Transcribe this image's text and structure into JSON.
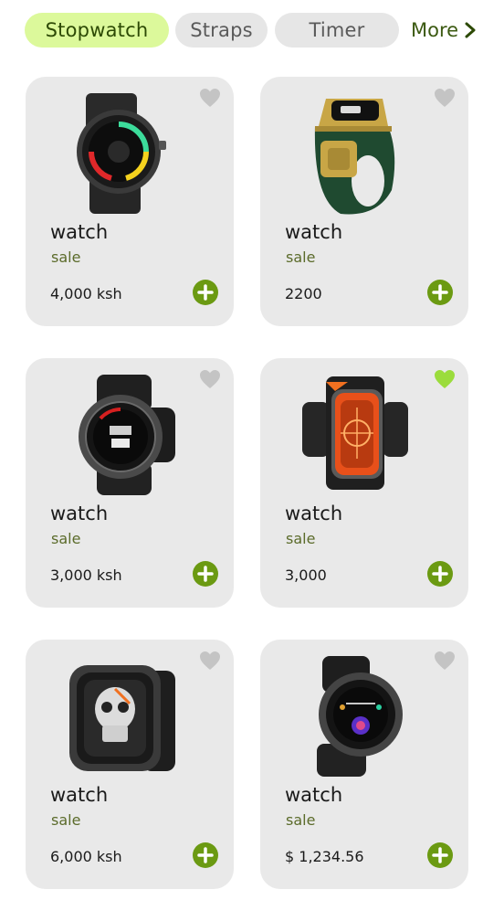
{
  "tabs": {
    "items": [
      "Stopwatch",
      "Straps",
      "Timer"
    ],
    "more_label": "More"
  },
  "colors": {
    "accent_chip": "#dcf99b",
    "accent_green": "#6b9a12",
    "heart_active": "#9bdc3c",
    "heart_inactive": "#c4c4c4",
    "card_bg": "#e9e9e9"
  },
  "products": [
    {
      "title": "watch",
      "sale": "sale",
      "price": "4,000 ksh",
      "favorite": false,
      "image": "rugged-smartwatch-image"
    },
    {
      "title": "watch",
      "sale": "sale",
      "price": "2200",
      "favorite": false,
      "image": "smart-ring-image"
    },
    {
      "title": "watch",
      "sale": "sale",
      "price": "3,000 ksh",
      "favorite": false,
      "image": "round-smartwatch-image"
    },
    {
      "title": "watch",
      "sale": "sale",
      "price": "3,000",
      "favorite": true,
      "image": "orange-square-smartwatch-image"
    },
    {
      "title": "watch",
      "sale": "sale",
      "price": "6,000 ksh",
      "favorite": false,
      "image": "skull-face-smartwatch-image"
    },
    {
      "title": "watch",
      "sale": "sale",
      "price": "$ 1,234.56",
      "favorite": false,
      "image": "black-round-smartwatch-image"
    }
  ]
}
